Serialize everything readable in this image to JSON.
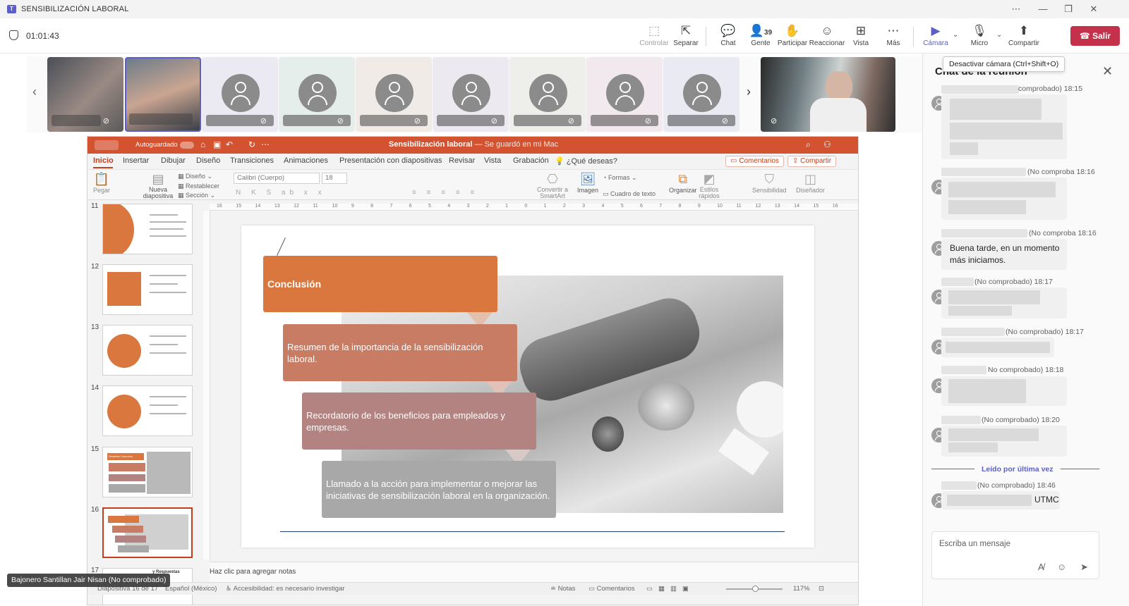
{
  "window": {
    "title": "SENSIBILIZACIÓN LABORAL",
    "logo_letter": "T",
    "controls": [
      "⋯",
      "—",
      "❐",
      "✕"
    ]
  },
  "meeting": {
    "timer": "01:01:43",
    "toolbar": [
      {
        "icon": "⬚",
        "label": "Controlar",
        "state": "disabled"
      },
      {
        "icon": "⇱",
        "label": "Separar",
        "state": "normal"
      },
      {
        "icon": "💬",
        "label": "Chat",
        "state": "normal"
      },
      {
        "icon": "👤",
        "label": "Gente",
        "state": "normal"
      },
      {
        "icon": "✋",
        "label": "Participar",
        "state": "normal"
      },
      {
        "icon": "☺",
        "label": "Reaccionar",
        "state": "normal"
      },
      {
        "icon": "⊞",
        "label": "Vista",
        "state": "normal"
      },
      {
        "icon": "⋯",
        "label": "Más",
        "state": "normal"
      },
      {
        "icon": "▶",
        "label": "Cámara",
        "state": "active"
      },
      {
        "icon": "🎙",
        "label": "Micro",
        "state": "normal"
      },
      {
        "icon": "⬆",
        "label": "Compartir",
        "state": "normal"
      }
    ],
    "people_count": "39",
    "leave_label": "Salir",
    "camera_tooltip": "Desactivar cámara (Ctrl+Shift+O)",
    "accent_color": "#5b5fc7",
    "leave_color": "#c4314b"
  },
  "presenter_name": "Bajonero Santillan Jair Nisan (No comprobado)",
  "powerpoint": {
    "autosave_label": "Autoguardado",
    "doc_title": "Sensibilización laboral",
    "doc_subtitle": "— Se guardó en mi Mac",
    "tabs": [
      "Inicio",
      "Insertar",
      "Dibujar",
      "Diseño",
      "Transiciones",
      "Animaciones",
      "Presentación con diapositivas",
      "Revisar",
      "Vista",
      "Grabación",
      "¿Qué deseas?"
    ],
    "comments_btn": "Comentarios",
    "share_btn": "Compartir",
    "ribbon": {
      "paste": "Pegar",
      "new_slide": "Nueva diapositiva",
      "layout": "Diseño",
      "reset": "Restablecer",
      "section": "Sección",
      "font_name": "Calibri (Cuerpo)",
      "font_size": "18",
      "convert_smartart": "Convertir a SmartArt",
      "image": "Imagen",
      "shapes": "Formas",
      "textbox": "Cuadro de texto",
      "organize": "Organizar",
      "quick_styles": "Estilos rápidos",
      "sensitivity": "Sensibilidad",
      "designer": "Diseñador"
    },
    "ruler_ticks": [
      "16",
      "15",
      "14",
      "13",
      "12",
      "11",
      "10",
      "9",
      "8",
      "7",
      "6",
      "5",
      "4",
      "3",
      "2",
      "1",
      "0",
      "1",
      "2",
      "3",
      "4",
      "5",
      "6",
      "7",
      "8",
      "9",
      "10",
      "11",
      "12",
      "13",
      "14",
      "15",
      "16"
    ],
    "slide_numbers": [
      "11",
      "12",
      "13",
      "14",
      "15",
      "16",
      "17"
    ],
    "selected_slide": "16",
    "thumb15_title": "Desafíos Comunes",
    "thumb17_title": "y Respuestas",
    "slide": {
      "title_box": "Conclusión",
      "step1": "Resumen de la importancia de la sensibilización laboral.",
      "step2": "Recordatorio de los beneficios para empleados y empresas.",
      "step3": "Llamado a la acción para implementar o mejorar las iniciativas de sensibilización laboral en la organización.",
      "colors": {
        "box1": "#d9773e",
        "box2": "#c97c64",
        "box3": "#b28380",
        "box4": "#a8a8a8"
      }
    },
    "notes_placeholder": "Haz clic para agregar notas",
    "status": {
      "slide_info": "Diapositiva 16 de 17",
      "language": "Español (México)",
      "accessibility": "Accesibilidad: es necesario investigar",
      "notes": "Notas",
      "comments": "Comentarios",
      "zoom": "117%"
    }
  },
  "chat": {
    "title": "Chat de la reunión",
    "messages": [
      {
        "meta": "comprobado)  18:15",
        "text": ""
      },
      {
        "meta": "(No comproba  18:16",
        "text": ""
      },
      {
        "meta": "(No comproba  18:16",
        "text": "Buena tarde, en un momento más iniciamos."
      },
      {
        "meta": "(No comprobado)  18:17",
        "text": ""
      },
      {
        "meta": "(No comprobado)  18:17",
        "text": ""
      },
      {
        "meta": "No comprobado)  18:18",
        "text": ""
      },
      {
        "meta": "(No comprobado)  18:20",
        "text": ""
      },
      {
        "meta": "(No comprobado)  18:46",
        "text": "UTMC"
      }
    ],
    "read_label": "Leído por última vez",
    "compose_placeholder": "Escriba un mensaje"
  }
}
